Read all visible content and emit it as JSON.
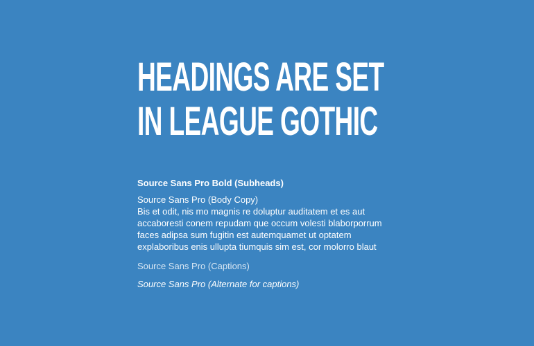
{
  "heading": {
    "line1": "HEADINGS ARE SET",
    "line2": "IN LEAGUE GOTHIC"
  },
  "subhead": "Source Sans Pro Bold (Subheads)",
  "body": {
    "title": "Source Sans Pro (Body Copy)",
    "lines": [
      "Bis et odit, nis mo magnis re doluptur auditatem et es aut",
      "accaboresti conem repudam que occum volesti blaborporrum",
      "faces adipsa sum fugitin est autemquamet ut optatem",
      "explaboribus enis ullupta tiumquis sim est, cor molorro blaut"
    ]
  },
  "caption": "Source Sans Pro (Captions)",
  "caption_alt": "Source Sans Pro (Alternate for captions)",
  "colors": {
    "background": "#3b84c1",
    "text": "#ffffff",
    "caption": "#d7e6f3"
  }
}
